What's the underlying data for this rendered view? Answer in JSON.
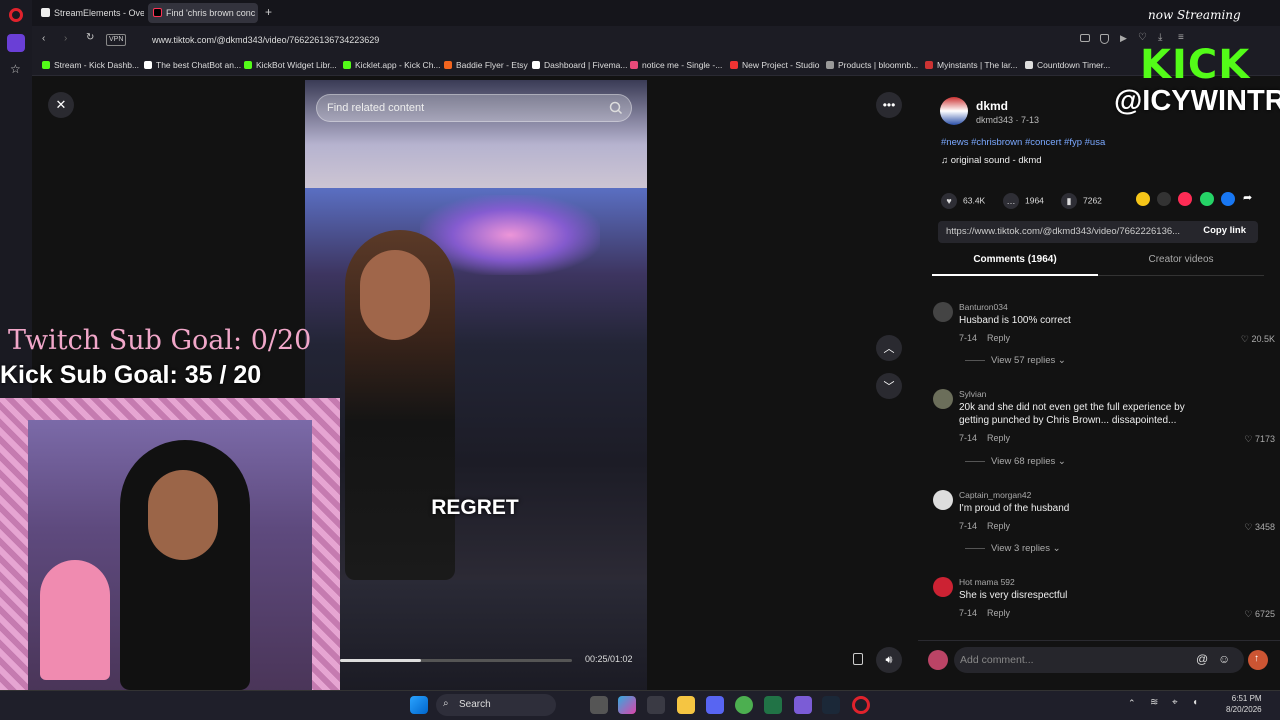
{
  "browser": {
    "tabs": [
      {
        "label": "StreamElements - Overlay"
      },
      {
        "label": "Find 'chris brown conc"
      }
    ],
    "vpn_label": "VPN",
    "url": "www.tiktok.com/@dkmd343/video/7662261367342236​29",
    "bookmarks": [
      {
        "label": "Stream - Kick Dashb...",
        "color": "#53fc18"
      },
      {
        "label": "The best ChatBot an...",
        "color": "#ffffff"
      },
      {
        "label": "KickBot Widget Libr...",
        "color": "#53fc18"
      },
      {
        "label": "Kicklet.app - Kick Ch...",
        "color": "#53fc18"
      },
      {
        "label": "Baddie Flyer - Etsy",
        "color": "#f1641e"
      },
      {
        "label": "Dashboard | Fivema...",
        "color": "#ffffff"
      },
      {
        "label": "notice me - Single -...",
        "color": "#e84a7a"
      },
      {
        "label": "New Project - Studio",
        "color": "#e33"
      },
      {
        "label": "Products | bloomnb...",
        "color": "#999"
      },
      {
        "label": "Myinstants | The lar...",
        "color": "#c33"
      },
      {
        "label": "Countdown Timer...",
        "color": "#ddd"
      }
    ]
  },
  "video": {
    "search_placeholder": "Find related content",
    "caption": "REGRET",
    "time": "00:25/01:02",
    "progress": 0.35
  },
  "post": {
    "author": "dkmd",
    "author_sub": "dkmd343 · 7-13",
    "hashtags": "#news #chrisbrown #concert #fyp #usa",
    "sound": "original sound - dkmd",
    "likes": "63.4K",
    "comments": "1964",
    "saves": "7262",
    "link": "https://www.tiktok.com/@dkmd343/video/7662226136...",
    "copy_link": "Copy link",
    "tab_comments": "Comments (1964)",
    "tab_creator": "Creator videos"
  },
  "comments": [
    {
      "user": "Banturon034",
      "text": "Husband is 100% correct",
      "date": "7-14",
      "reply": "Reply",
      "likes": "20.5K",
      "view": "View 57 replies"
    },
    {
      "user": "Sylvian",
      "text": "20k and she did not even get the full experience by getting punched by Chris Brown... dissapointed...",
      "date": "7-14",
      "reply": "Reply",
      "likes": "7173",
      "view": "View 68 replies"
    },
    {
      "user": "Captain_morgan42",
      "text": "I'm proud of the husband",
      "date": "7-14",
      "reply": "Reply",
      "likes": "3458",
      "view": "View 3 replies"
    },
    {
      "user": "Hot mama 592",
      "text": "She is very disrespectful",
      "date": "7-14",
      "reply": "Reply",
      "likes": "6725",
      "view": ""
    }
  ],
  "add_comment_placeholder": "Add comment...",
  "overlay": {
    "twitch_goal": "Twitch Sub Goal: 0/20",
    "kick_goal": "Kick Sub Goal: 35 / 20",
    "now_streaming": "now Streaming",
    "kick_logo": "KICK",
    "kick_handle": "@ICYWINTRR"
  },
  "taskbar": {
    "search": "Search",
    "time": "6:51 PM",
    "date": "8/20/2026"
  }
}
